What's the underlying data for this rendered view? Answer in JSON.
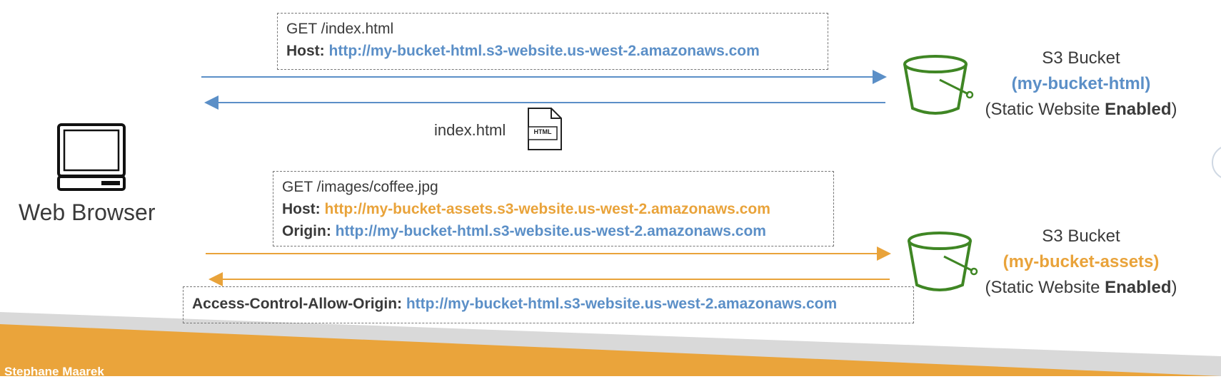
{
  "browser": {
    "label": "Web Browser",
    "icon": "computer-monitor-icon"
  },
  "request1": {
    "line1": "GET /index.html",
    "host_label": "Host:",
    "host_value": "http://my-bucket-html.s3-website.us-west-2.amazonaws.com"
  },
  "response1": {
    "file_label": "index.html",
    "file_icon_text": "HTML"
  },
  "bucket1": {
    "title": "S3 Bucket",
    "name": "(my-bucket-html)",
    "status_prefix": "(Static Website ",
    "status_bold": "Enabled",
    "status_suffix": ")"
  },
  "request2": {
    "line1": "GET /images/coffee.jpg",
    "host_label": "Host:",
    "host_value": "http://my-bucket-assets.s3-website.us-west-2.amazonaws.com",
    "origin_label": "Origin:",
    "origin_value": "http://my-bucket-html.s3-website.us-west-2.amazonaws.com"
  },
  "response2": {
    "header_label": "Access-Control-Allow-Origin:",
    "header_value": "http://my-bucket-html.s3-website.us-west-2.amazonaws.com"
  },
  "bucket2": {
    "title": "S3 Bucket",
    "name": "(my-bucket-assets)",
    "status_prefix": "(Static Website ",
    "status_bold": "Enabled",
    "status_suffix": ")"
  },
  "footer": {
    "author": "Stephane Maarek"
  },
  "colors": {
    "blue": "#5b8fc7",
    "orange": "#e9a33a",
    "bucket_green": "#3f8624"
  }
}
